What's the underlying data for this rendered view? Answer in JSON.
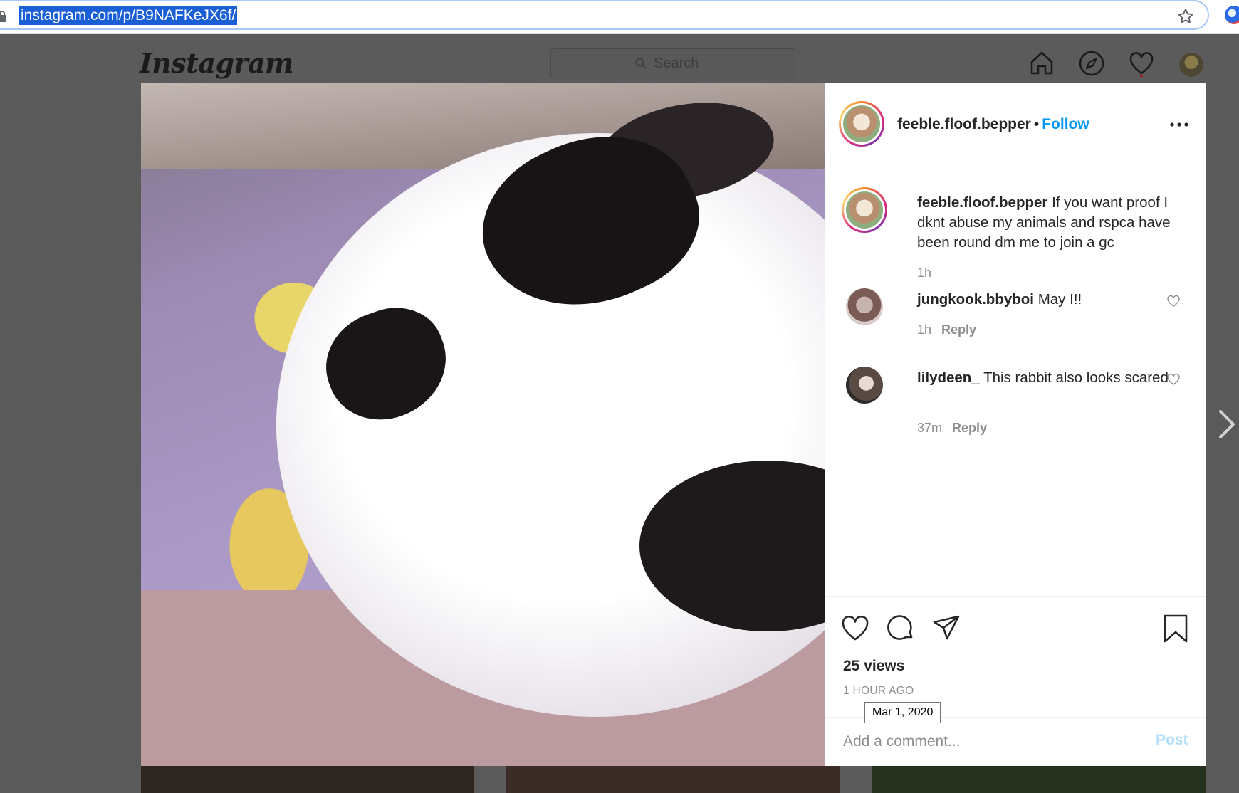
{
  "browser": {
    "url": "instagram.com/p/B9NAFKeJX6f/"
  },
  "header": {
    "logo": "Instagram",
    "search_placeholder": "Search"
  },
  "post": {
    "username": "feeble.floof.bepper",
    "separator": "•",
    "follow_label": "Follow",
    "caption": {
      "username": "feeble.floof.bepper",
      "text": "If you want proof I dknt abuse my animals and rspca have been round dm me to join a gc",
      "time": "1h"
    },
    "comments": [
      {
        "username": "jungkook.bbyboi",
        "text": "May I!!",
        "time": "1h",
        "reply_label": "Reply"
      },
      {
        "username": "lilydeen_",
        "text": "This rabbit also looks scared",
        "time": "37m",
        "reply_label": "Reply"
      }
    ],
    "views": "25 views",
    "time_ago": "1 HOUR AGO",
    "tooltip_date": "Mar 1, 2020",
    "add_comment_placeholder": "Add a comment...",
    "post_label": "Post"
  },
  "icons": {
    "nav": [
      "home-icon",
      "explore-icon",
      "activity-heart-icon",
      "profile-avatar"
    ],
    "actions": [
      "like-heart-icon",
      "comment-bubble-icon",
      "share-paper-plane-icon",
      "save-bookmark-icon"
    ]
  },
  "colors": {
    "accent_blue": "#0095f6",
    "post_disabled": "#b2dffc",
    "overlay": "#5a5a5a",
    "media_letterbox": "#bc9ba0"
  }
}
